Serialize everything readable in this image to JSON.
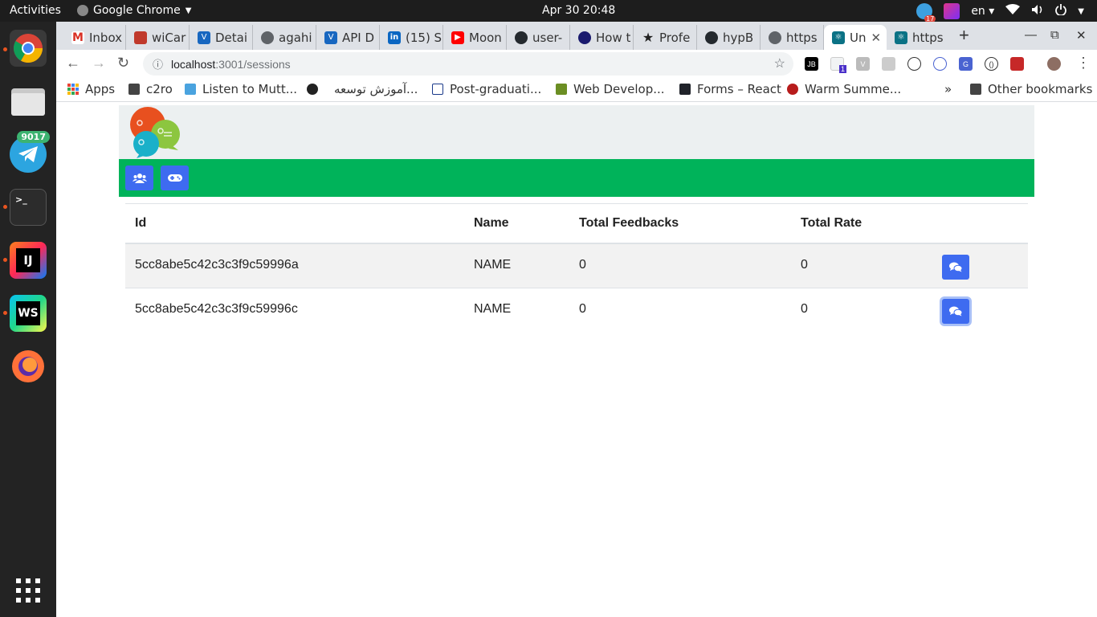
{
  "topbar": {
    "activities": "Activities",
    "app_name": "Google Chrome",
    "clock": "Apr 30  20:48",
    "lang": "en",
    "tray_badge": "17"
  },
  "dock": {
    "telegram_badge": "9017",
    "intellij_label": "IJ",
    "webstorm_label": "WS"
  },
  "tabs": [
    {
      "label": "Inbox",
      "icon": "gmail-icon",
      "color": "#d93025"
    },
    {
      "label": "wiCar",
      "icon": "wicar-icon",
      "color": "#c0392b"
    },
    {
      "label": "Detai",
      "icon": "vuetify-icon",
      "color": "#1867c0"
    },
    {
      "label": "agahi",
      "icon": "globe-icon",
      "color": "#5f6368"
    },
    {
      "label": "API D",
      "icon": "vuetify-icon",
      "color": "#1867c0"
    },
    {
      "label": "(15) S",
      "icon": "linkedin-icon",
      "color": "#0a66c2"
    },
    {
      "label": "Moon",
      "icon": "youtube-icon",
      "color": "#ff0000"
    },
    {
      "label": "user-",
      "icon": "github-icon",
      "color": "#24292e"
    },
    {
      "label": "How t",
      "icon": "circle-icon",
      "color": "#1a1a6e"
    },
    {
      "label": "Profe",
      "icon": "star-icon",
      "color": "#222222"
    },
    {
      "label": "hypB",
      "icon": "github-icon",
      "color": "#24292e"
    },
    {
      "label": "https",
      "icon": "globe-icon",
      "color": "#5f6368"
    },
    {
      "label": "Un",
      "icon": "react-icon",
      "color": "#0b7285"
    },
    {
      "label": "https",
      "icon": "react-icon",
      "color": "#0b7285"
    }
  ],
  "toolbar": {
    "url_host": "localhost",
    "url_path": ":3001/sessions",
    "ext_badge": "1"
  },
  "bookmarks": [
    {
      "label": "Apps"
    },
    {
      "label": "c2ro"
    },
    {
      "label": "Listen to Mutt..."
    },
    {
      "label": "آموزش توسعه..."
    },
    {
      "label": "Post-graduati..."
    },
    {
      "label": "Web Develop..."
    },
    {
      "label": "Forms – React"
    },
    {
      "label": "Warm Summe..."
    }
  ],
  "bookmarks_other": "Other bookmarks",
  "bookmarks_more": "»",
  "page": {
    "colors": {
      "header_bg": "#ecf0f1",
      "navbar_bg": "#00b35a",
      "button_bg": "#3e6bf0"
    },
    "nav_buttons": [
      "users-icon",
      "gamepad-icon"
    ],
    "table": {
      "headers": [
        "Id",
        "Name",
        "Total Feedbacks",
        "Total Rate",
        ""
      ],
      "rows": [
        {
          "id": "5cc8abe5c42c3c3f9c59996a",
          "name": "NAME",
          "total_feedbacks": "0",
          "total_rate": "0",
          "action_icon": "comments-icon"
        },
        {
          "id": "5cc8abe5c42c3c3f9c59996c",
          "name": "NAME",
          "total_feedbacks": "0",
          "total_rate": "0",
          "action_icon": "comments-icon"
        }
      ]
    }
  }
}
